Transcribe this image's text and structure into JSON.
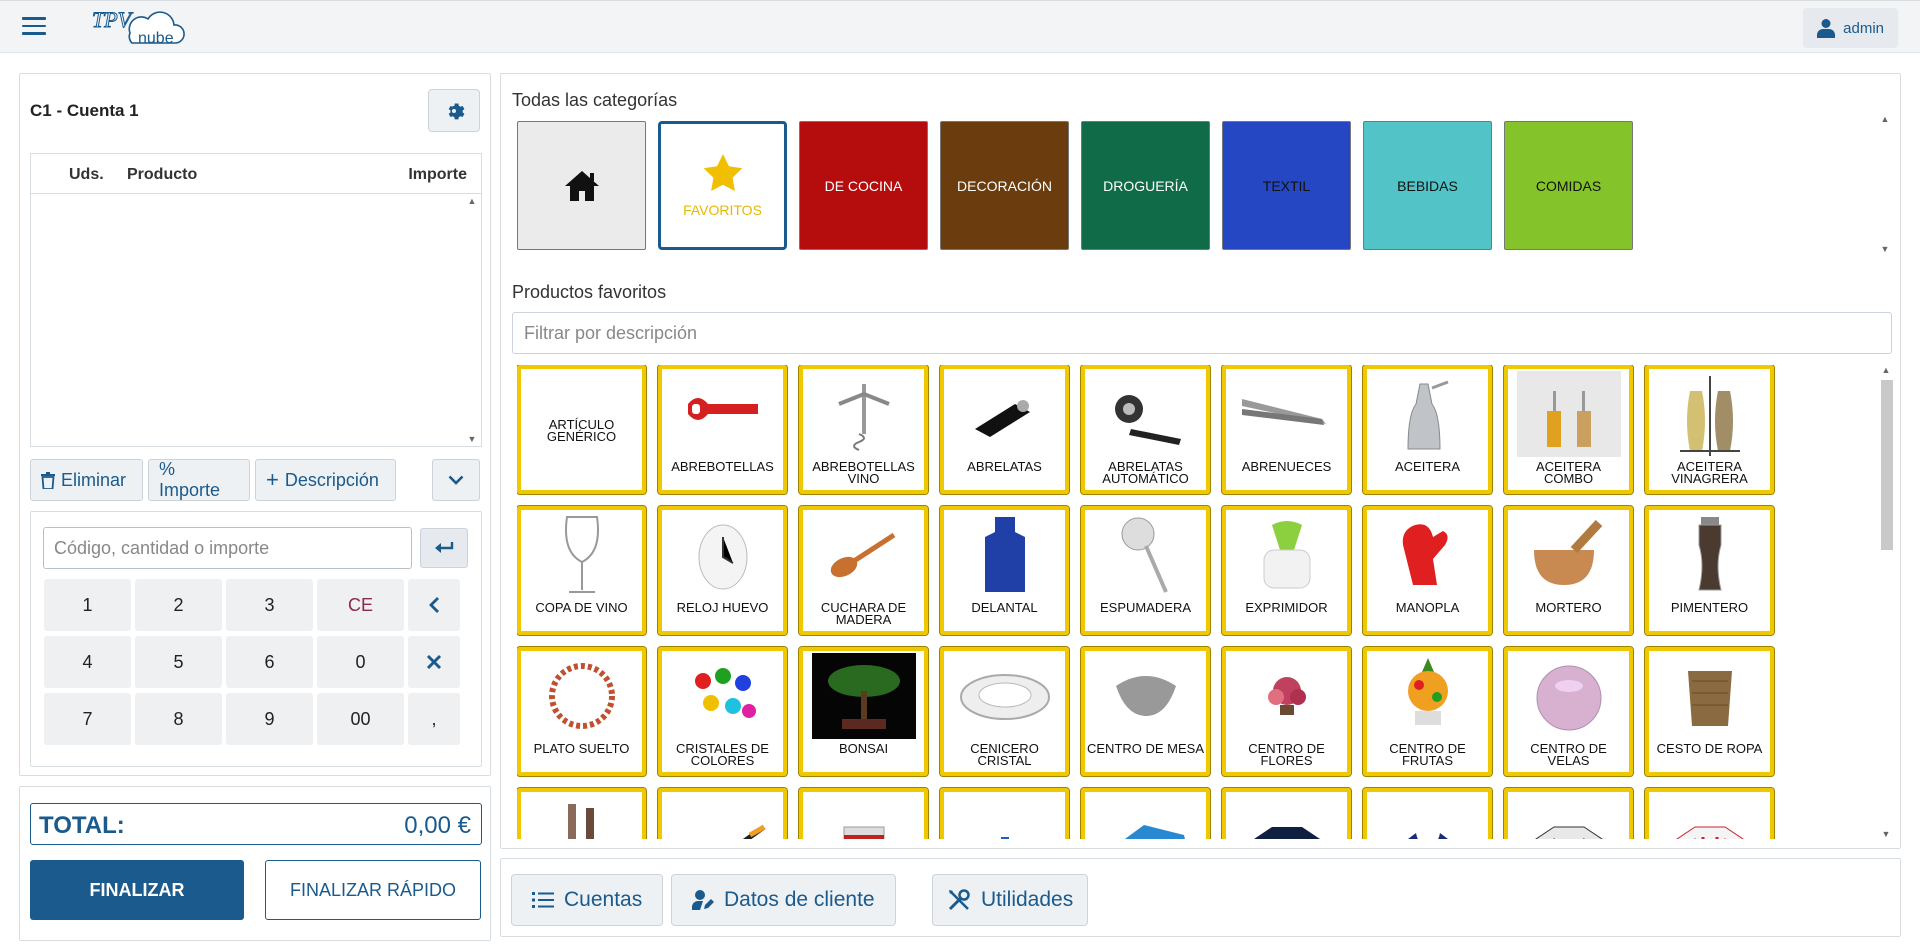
{
  "header": {
    "logo_top": "TPV",
    "logo_bottom": "nube",
    "user": "admin"
  },
  "account": {
    "title": "C1 - Cuenta 1",
    "columns": {
      "units": "Uds.",
      "product": "Producto",
      "amount": "Importe"
    },
    "actions": {
      "delete": "Eliminar",
      "percent": "% Importe",
      "description": "Descripción"
    },
    "code_placeholder": "Código, cantidad o importe",
    "keys": [
      "1",
      "2",
      "3",
      "CE",
      "",
      "4",
      "5",
      "6",
      "0",
      "",
      "7",
      "8",
      "9",
      "00",
      ","
    ]
  },
  "totals": {
    "label": "TOTAL:",
    "value": "0,00 €",
    "finish": "FINALIZAR",
    "quick_finish": "FINALIZAR RÁPIDO"
  },
  "categories": {
    "title": "Todas las categorías",
    "items": [
      {
        "label": "",
        "bg": "#ebebeb"
      },
      {
        "label": "FAVORITOS",
        "bg": "#ffffff"
      },
      {
        "label": "DE COCINA",
        "bg": "#b50d0d",
        "fg": "#ffffff"
      },
      {
        "label": "DECORACIÓN",
        "bg": "#6b3c0e",
        "fg": "#ffffff"
      },
      {
        "label": "DROGUERÍA",
        "bg": "#0f6b48",
        "fg": "#ffffff"
      },
      {
        "label": "TEXTIL",
        "bg": "#2547c4",
        "fg": "#111111"
      },
      {
        "label": "BEBIDAS",
        "bg": "#52c4c8",
        "fg": "#111111"
      },
      {
        "label": "COMIDAS",
        "bg": "#84c42a",
        "fg": "#111111"
      }
    ]
  },
  "products": {
    "title": "Productos favoritos",
    "filter_placeholder": "Filtrar por descripción",
    "items": [
      {
        "name": "ARTÍCULO GENÉRICO",
        "icon": "none"
      },
      {
        "name": "ABREBOTELLAS",
        "icon": "bottle-opener"
      },
      {
        "name": "ABREBOTELLAS VINO",
        "icon": "corkscrew"
      },
      {
        "name": "ABRELATAS",
        "icon": "can-opener"
      },
      {
        "name": "ABRELATAS AUTOMÁTICO",
        "icon": "auto-can-opener"
      },
      {
        "name": "ABRENUECES",
        "icon": "nutcracker"
      },
      {
        "name": "ACEITERA",
        "icon": "oil-cruet"
      },
      {
        "name": "ACEITERA COMBO",
        "icon": "cruet-set"
      },
      {
        "name": "ACEITERA VINAGRERA",
        "icon": "cruet-stand"
      },
      {
        "name": "COPA DE VINO",
        "icon": "wine-glass"
      },
      {
        "name": "RELOJ HUEVO",
        "icon": "egg-timer"
      },
      {
        "name": "CUCHARA DE MADERA",
        "icon": "wooden-spoon"
      },
      {
        "name": "DELANTAL",
        "icon": "apron"
      },
      {
        "name": "ESPUMADERA",
        "icon": "skimmer"
      },
      {
        "name": "EXPRIMIDOR",
        "icon": "juicer"
      },
      {
        "name": "MANOPLA",
        "icon": "oven-mitt"
      },
      {
        "name": "MORTERO",
        "icon": "mortar"
      },
      {
        "name": "PIMENTERO",
        "icon": "pepper-mill"
      },
      {
        "name": "PLATO SUELTO",
        "icon": "plate"
      },
      {
        "name": "CRISTALES DE COLORES",
        "icon": "colored-glass"
      },
      {
        "name": "BONSAI",
        "icon": "bonsai"
      },
      {
        "name": "CENICERO CRISTAL",
        "icon": "ashtray"
      },
      {
        "name": "CENTRO DE MESA",
        "icon": "centerpiece"
      },
      {
        "name": "CENTRO DE FLORES",
        "icon": "flowers"
      },
      {
        "name": "CENTRO DE FRUTAS",
        "icon": "fruits"
      },
      {
        "name": "CENTRO DE VELAS",
        "icon": "candles"
      },
      {
        "name": "CESTO DE ROPA",
        "icon": "laundry-basket"
      },
      {
        "name": "",
        "icon": "figurines"
      },
      {
        "name": "",
        "icon": "pan"
      },
      {
        "name": "",
        "icon": "paint-can"
      },
      {
        "name": "",
        "icon": "bottle"
      },
      {
        "name": "",
        "icon": "cloth"
      },
      {
        "name": "",
        "icon": "tshirt"
      },
      {
        "name": "",
        "icon": "tank-top"
      },
      {
        "name": "",
        "icon": "printed-tshirt"
      },
      {
        "name": "",
        "icon": "jersey"
      }
    ]
  },
  "tools": {
    "accounts": "Cuentas",
    "client": "Datos de cliente",
    "utilities": "Utilidades"
  }
}
